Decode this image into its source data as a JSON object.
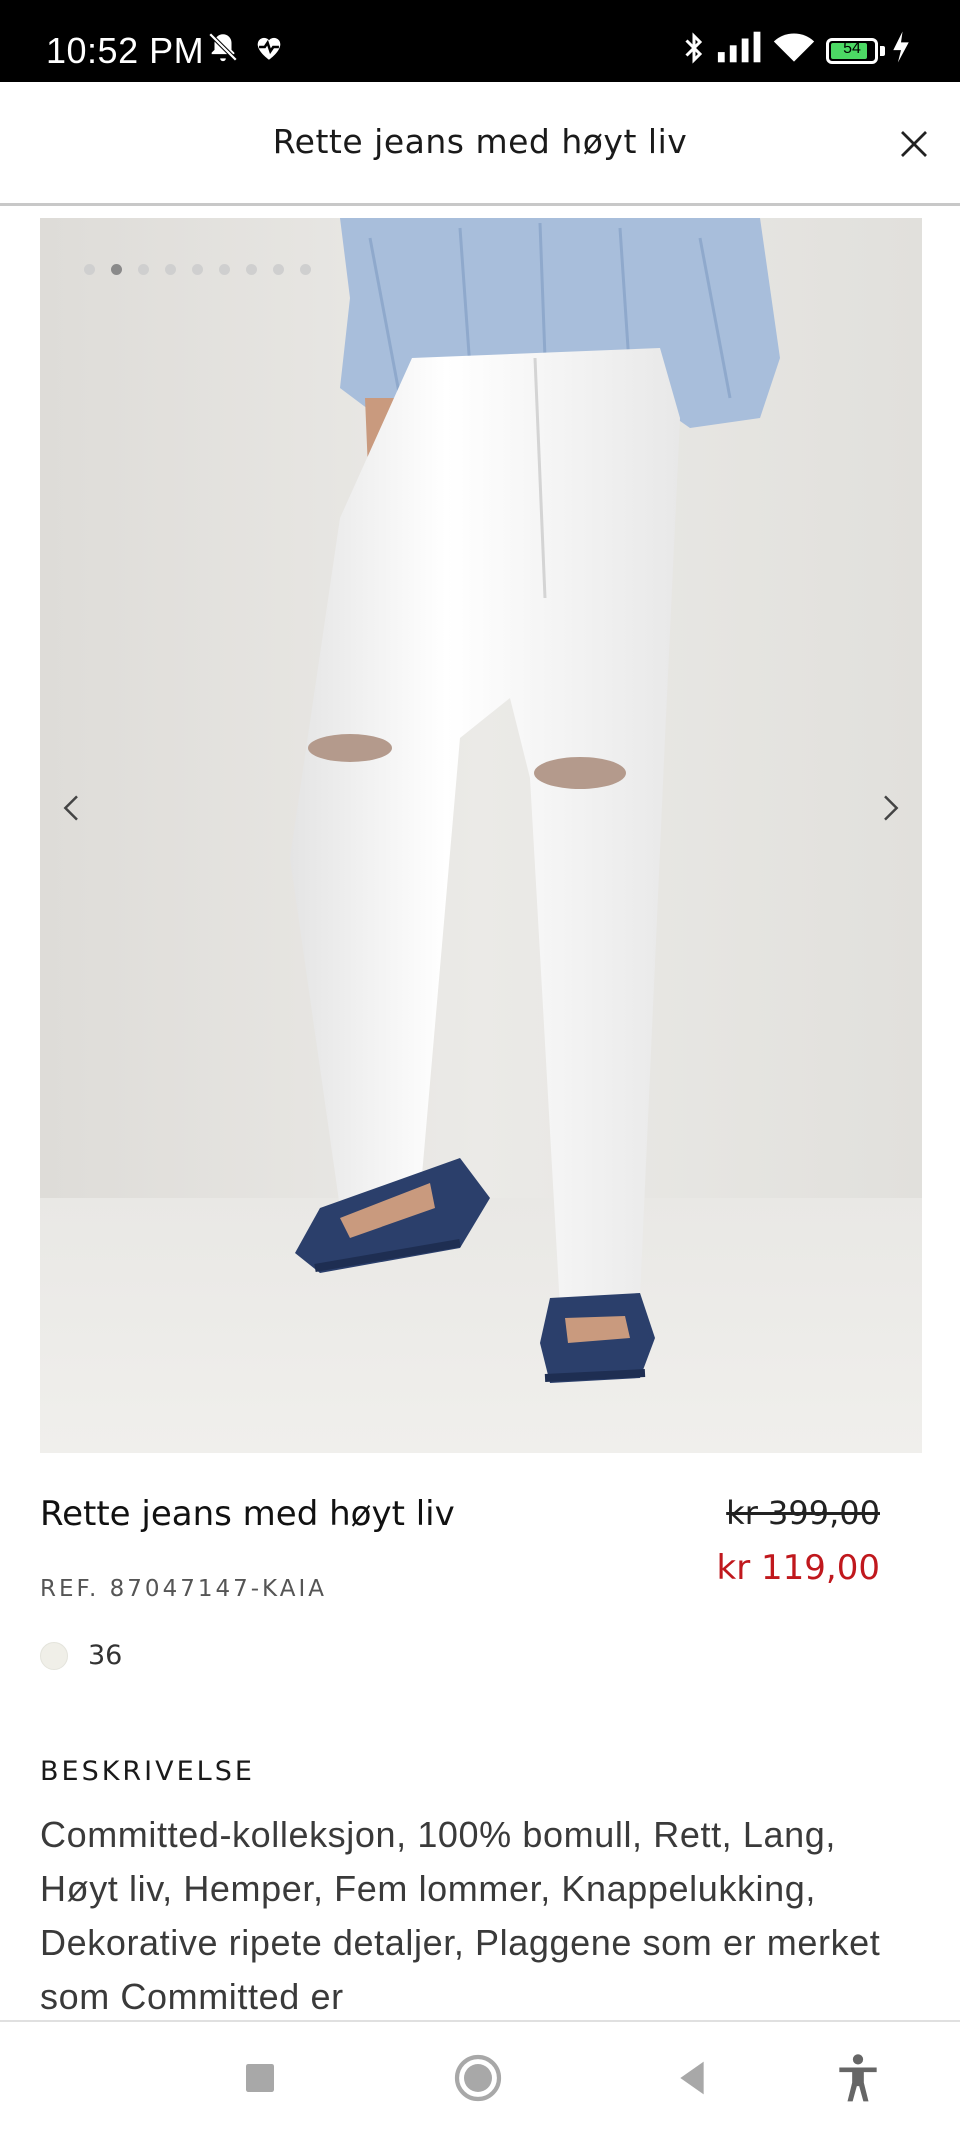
{
  "status_bar": {
    "time": "10:52 PM",
    "battery": "54",
    "icons": [
      "bell-off-icon",
      "heart-pulse-icon",
      "bluetooth-icon",
      "signal-icon",
      "wifi-icon",
      "battery-icon",
      "charging-icon"
    ]
  },
  "header": {
    "title": "Rette jeans med høyt liv",
    "close_icon": "close-icon"
  },
  "gallery": {
    "image_count": 9,
    "active_index": 1,
    "image_alt": "white high-waist straight jeans with ripped knees worn with striped blue shirt and navy sandals"
  },
  "product": {
    "name": "Rette jeans med høyt liv",
    "old_price": "kr 399,00",
    "new_price": "kr 119,00",
    "reference": "REF. 87047147-KAIA",
    "size": "36",
    "swatch_color": "#f0efe8"
  },
  "description": {
    "heading": "BESKRIVELSE",
    "text": "Committed-kolleksjon, 100% bomull, Rett, Lang, Høyt liv, Hemper, Fem lommer, Knappelukking, Dekorative ripete detaljer, Plaggene som er merket som Committed er"
  },
  "nav_bar": {
    "buttons": [
      "recents-icon",
      "home-icon",
      "back-icon",
      "accessibility-icon"
    ]
  },
  "colors": {
    "sale_red": "#c0181d",
    "image_bg": "#e6e5e2"
  }
}
